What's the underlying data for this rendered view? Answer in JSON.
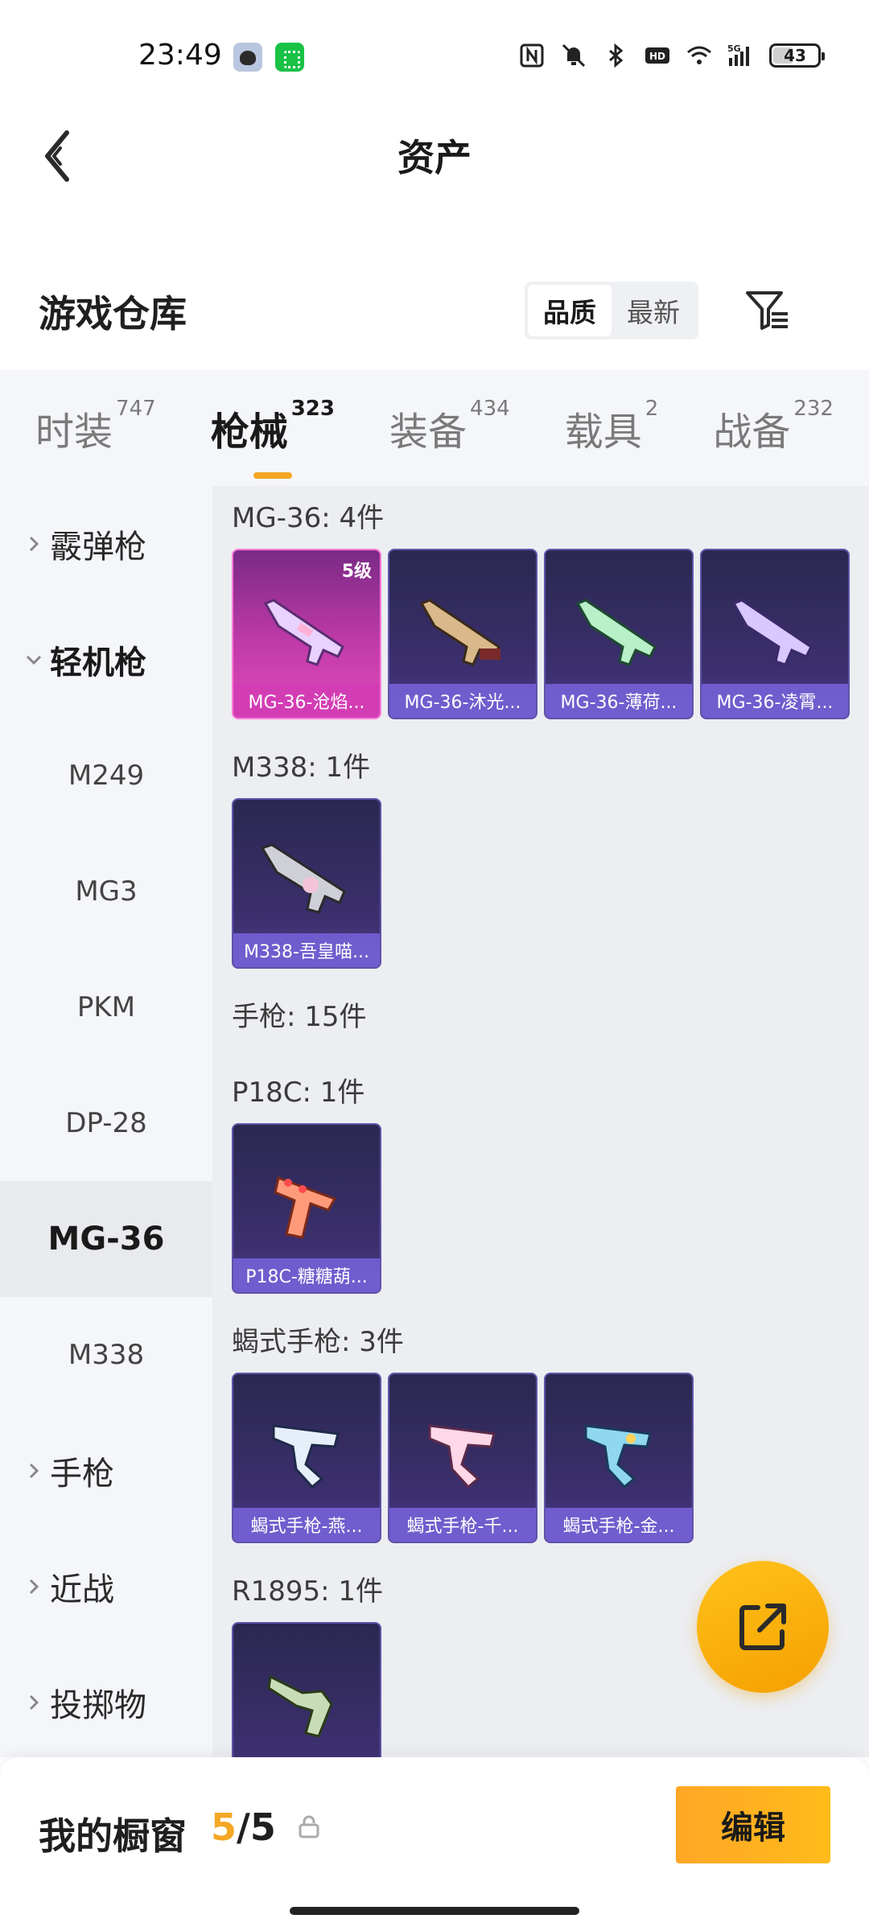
{
  "status_bar": {
    "time": "23:49",
    "battery": "43",
    "battery_level": 0.43,
    "icons": [
      "nfc-icon",
      "mute-icon",
      "bluetooth-icon",
      "hd-icon",
      "wifi-icon",
      "signal-5g-icon",
      "battery-icon"
    ]
  },
  "header": {
    "title": "资产",
    "back_icon": "chevron-left-icon"
  },
  "section": {
    "title": "游戏仓库",
    "sort_options": [
      "品质",
      "最新"
    ],
    "sort_selected": "品质",
    "filter_icon": "filter-list-icon"
  },
  "category_tabs": [
    {
      "label": "时装",
      "count": "747",
      "active": false
    },
    {
      "label": "枪械",
      "count": "323",
      "active": true
    },
    {
      "label": "装备",
      "count": "434",
      "active": false
    },
    {
      "label": "载具",
      "count": "2",
      "active": false
    },
    {
      "label": "战备",
      "count": "232",
      "active": false
    }
  ],
  "sidebar": {
    "groups": [
      {
        "label": "霰弹枪",
        "open": false
      },
      {
        "label": "轻机枪",
        "open": true
      },
      {
        "label": "手枪",
        "open": false
      },
      {
        "label": "近战",
        "open": false
      },
      {
        "label": "投掷物",
        "open": false
      }
    ],
    "sub_items": [
      "M249",
      "MG3",
      "PKM",
      "DP-28",
      "MG-36",
      "M338"
    ],
    "selected": "MG-36"
  },
  "content": {
    "groups": [
      {
        "title": "MG-36: 4件",
        "items": [
          {
            "name": "MG-36-沧焰...",
            "level": "5级",
            "rarity": "gold"
          },
          {
            "name": "MG-36-沐光...",
            "rarity": "purple"
          },
          {
            "name": "MG-36-薄荷...",
            "rarity": "purple"
          },
          {
            "name": "MG-36-凌霄...",
            "rarity": "purple"
          }
        ]
      },
      {
        "title": "M338: 1件",
        "items": [
          {
            "name": "M338-吾皇喵...",
            "rarity": "purple"
          }
        ]
      },
      {
        "title": "手枪: 15件",
        "items": []
      },
      {
        "title": "P18C: 1件",
        "items": [
          {
            "name": "P18C-糖糖葫...",
            "rarity": "purple"
          }
        ]
      },
      {
        "title": "蝎式手枪: 3件",
        "items": [
          {
            "name": "蝎式手枪-燕...",
            "rarity": "purple"
          },
          {
            "name": "蝎式手枪-千...",
            "rarity": "purple"
          },
          {
            "name": "蝎式手枪-金...",
            "rarity": "purple"
          }
        ]
      },
      {
        "title": "R1895: 1件",
        "items": [
          {
            "name": "",
            "rarity": "purple"
          }
        ]
      }
    ]
  },
  "fab": {
    "icon": "share-external-icon"
  },
  "bottom_bar": {
    "label": "我的橱窗",
    "count_current": "5",
    "count_sep": "/",
    "count_total": "5",
    "lock_icon": "lock-icon",
    "edit_label": "编辑"
  },
  "colors": {
    "accent": "#f5a623",
    "card_purple": "#3c2f6e",
    "card_gold": "#c03aa8"
  }
}
